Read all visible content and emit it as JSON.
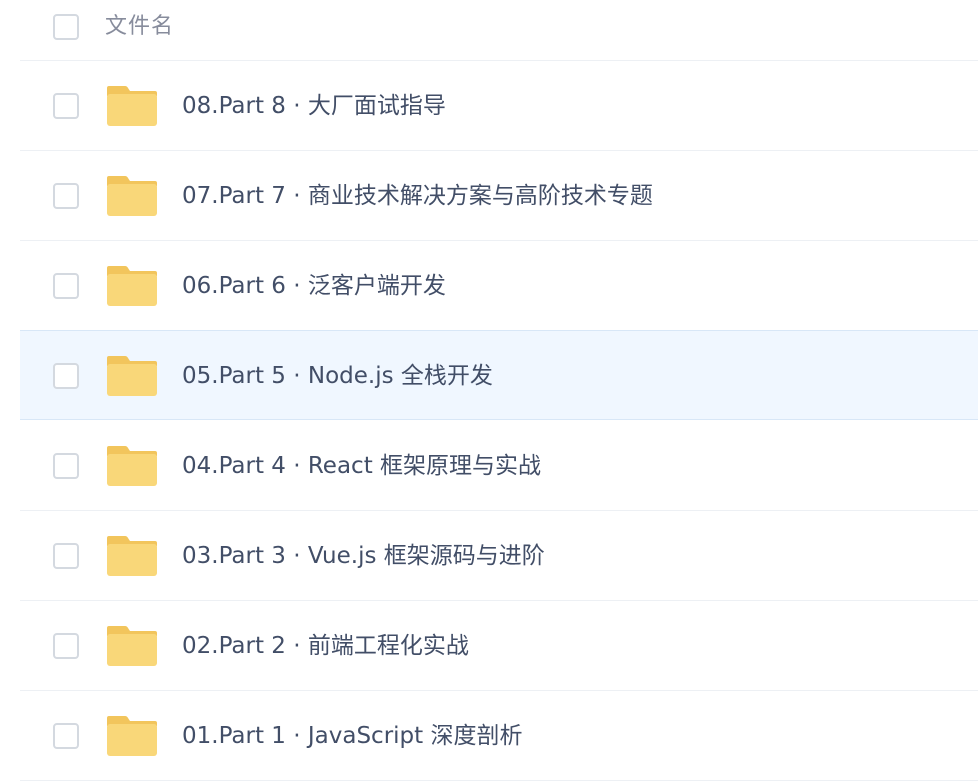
{
  "header": {
    "column_label": "文件名"
  },
  "colors": {
    "folder_fill": "#f9d779",
    "folder_tab": "#f2c55c",
    "hover_row_bg": "#f0f7ff",
    "text": "#424e67",
    "header_text": "#878c9c"
  },
  "files": [
    {
      "name": "08.Part 8 · 大厂面试指导",
      "icon": "folder-icon"
    },
    {
      "name": "07.Part 7 · 商业技术解决方案与高阶技术专题",
      "icon": "folder-icon"
    },
    {
      "name": "06.Part 6 · 泛客户端开发",
      "icon": "folder-icon"
    },
    {
      "name": "05.Part 5 · Node.js 全栈开发",
      "icon": "folder-icon",
      "hovered": true
    },
    {
      "name": "04.Part 4 · React 框架原理与实战",
      "icon": "folder-icon"
    },
    {
      "name": "03.Part 3 · Vue.js 框架源码与进阶",
      "icon": "folder-icon"
    },
    {
      "name": "02.Part 2 · 前端工程化实战",
      "icon": "folder-icon"
    },
    {
      "name": "01.Part 1 · JavaScript 深度剖析",
      "icon": "folder-icon"
    }
  ]
}
